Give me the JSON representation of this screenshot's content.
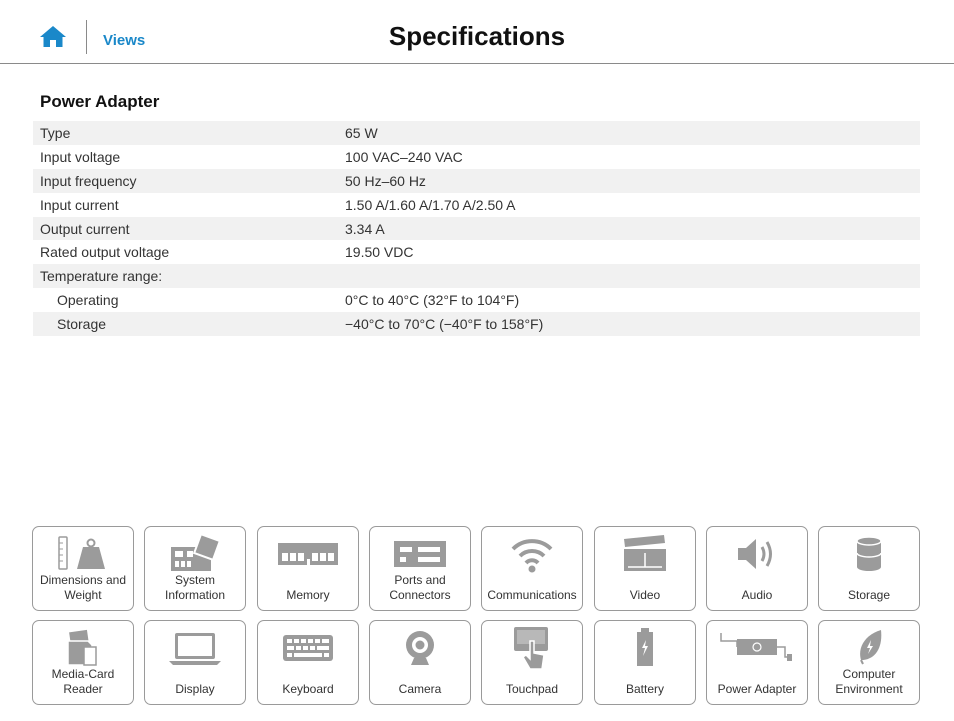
{
  "header": {
    "title": "Specifications",
    "nav_link": "Views",
    "home_icon": "home-icon"
  },
  "section": {
    "title": "Power Adapter",
    "rows": [
      {
        "label": "Type",
        "value": "65 W"
      },
      {
        "label": "Input voltage",
        "value": "100 VAC–240 VAC"
      },
      {
        "label": "Input frequency",
        "value": "50 Hz–60 Hz"
      },
      {
        "label": "Input current",
        "value": "1.50 A/1.60 A/1.70 A/2.50 A"
      },
      {
        "label": "Output current",
        "value": "3.34 A"
      },
      {
        "label": "Rated output voltage",
        "value": "19.50 VDC"
      },
      {
        "label": "Temperature range:",
        "value": ""
      },
      {
        "label": "Operating",
        "value": "0°C to 40°C (32°F to 104°F)"
      },
      {
        "label": "Storage",
        "value": "−40°C to 70°C (−40°F to 158°F)"
      }
    ]
  },
  "tiles": [
    {
      "label": "Dimensions and Weight",
      "icon": "weight-icon"
    },
    {
      "label": "System Information",
      "icon": "motherboard-icon"
    },
    {
      "label": "Memory",
      "icon": "memory-icon"
    },
    {
      "label": "Ports and Connectors",
      "icon": "ports-icon"
    },
    {
      "label": "Communications",
      "icon": "wifi-icon"
    },
    {
      "label": "Video",
      "icon": "clapperboard-icon"
    },
    {
      "label": "Audio",
      "icon": "speaker-icon"
    },
    {
      "label": "Storage",
      "icon": "database-icon"
    },
    {
      "label": "Media-Card Reader",
      "icon": "media-card-icon"
    },
    {
      "label": "Display",
      "icon": "laptop-icon"
    },
    {
      "label": "Keyboard",
      "icon": "keyboard-icon"
    },
    {
      "label": "Camera",
      "icon": "webcam-icon"
    },
    {
      "label": "Touchpad",
      "icon": "touchpad-icon"
    },
    {
      "label": "Battery",
      "icon": "battery-icon"
    },
    {
      "label": "Power Adapter",
      "icon": "power-adapter-icon"
    },
    {
      "label": "Computer Environment",
      "icon": "leaf-icon"
    }
  ],
  "colors": {
    "accent": "#1a88c9",
    "row_shade": "#f1f1f1",
    "icon_gray": "#9b9b9b"
  }
}
